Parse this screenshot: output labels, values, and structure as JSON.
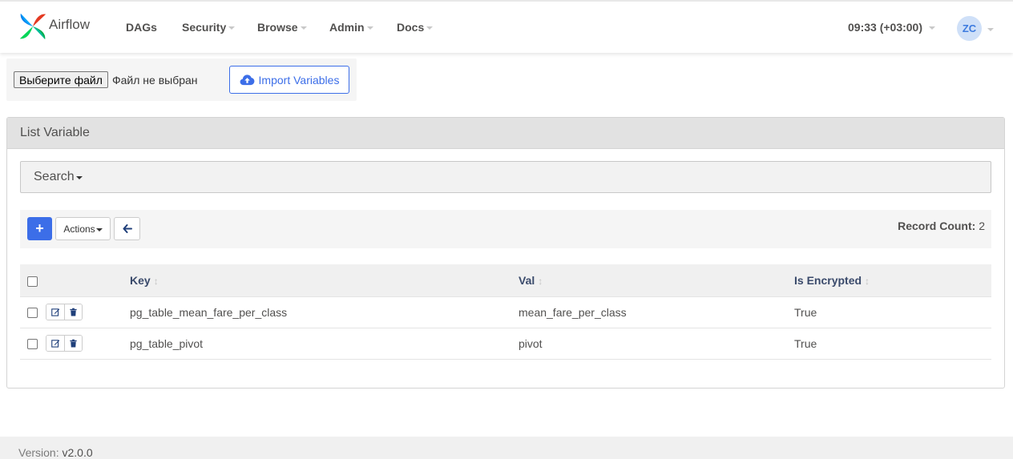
{
  "navbar": {
    "brand": "Airflow",
    "menu": [
      {
        "label": "DAGs",
        "dropdown": false
      },
      {
        "label": "Security",
        "dropdown": true
      },
      {
        "label": "Browse",
        "dropdown": true
      },
      {
        "label": "Admin",
        "dropdown": true
      },
      {
        "label": "Docs",
        "dropdown": true
      }
    ],
    "clock": "09:33 (+03:00)",
    "avatar_initials": "ZC"
  },
  "import_form": {
    "file_button_label": "Выберите файл",
    "file_status": "Файл не выбран",
    "import_button_label": "Import Variables",
    "import_icon": "cloud-upload-icon"
  },
  "panel": {
    "title": "List Variable",
    "search_label": "Search",
    "toolbar": {
      "add_label": "+",
      "actions_label": "Actions",
      "back_icon": "arrow-left-icon",
      "record_count_label": "Record Count:",
      "record_count_value": "2"
    },
    "table": {
      "columns": [
        "Key",
        "Val",
        "Is Encrypted"
      ],
      "rows": [
        {
          "key": "pg_table_mean_fare_per_class",
          "val": "mean_fare_per_class",
          "is_encrypted": "True"
        },
        {
          "key": "pg_table_pivot",
          "val": "pivot",
          "is_encrypted": "True"
        }
      ]
    }
  },
  "footer": {
    "version_label": "Version:",
    "version_value": "v2.0.0"
  },
  "colors": {
    "accent": "#3c6ee8",
    "header_bg": "#e2e2e2",
    "table_header_text": "#3a4a6b"
  }
}
